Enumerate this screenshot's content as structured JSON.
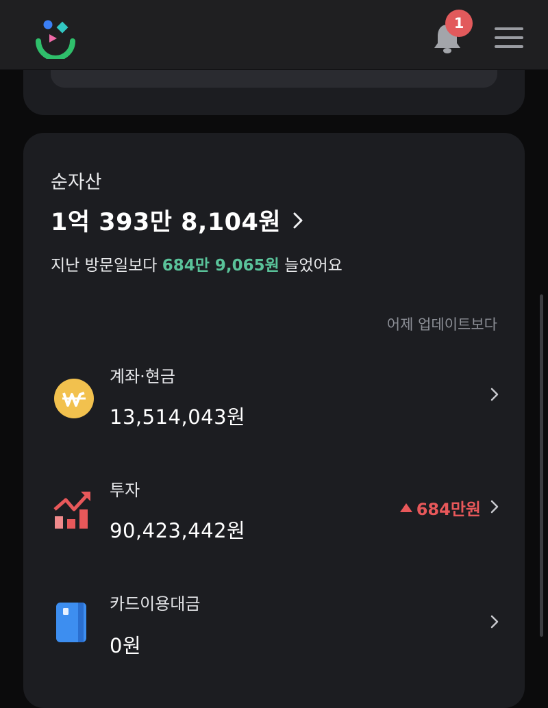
{
  "header": {
    "notification_count": "1",
    "logo_icon": "app-logo-icon",
    "bell_icon": "bell-icon",
    "menu_icon": "hamburger-menu-icon"
  },
  "net_assets": {
    "title": "순자산",
    "total": "1억 393만 8,104원",
    "diff_prefix": "지난 방문일보다",
    "diff_value": "684만 9,065원",
    "diff_suffix": "늘었어요",
    "update_note": "어제 업데이트보다"
  },
  "accounts": [
    {
      "label": "계좌·현금",
      "value": "13,514,043원",
      "icon": "won-coin-icon",
      "change": ""
    },
    {
      "label": "투자",
      "value": "90,423,442원",
      "icon": "investment-chart-icon",
      "change": "684만원"
    },
    {
      "label": "카드이용대금",
      "value": "0원",
      "icon": "card-icon",
      "change": ""
    }
  ],
  "colors": {
    "positive": "#5ac39a",
    "increase": "#e8585a",
    "coin": "#f2c14e",
    "card": "#3d8ef0"
  }
}
